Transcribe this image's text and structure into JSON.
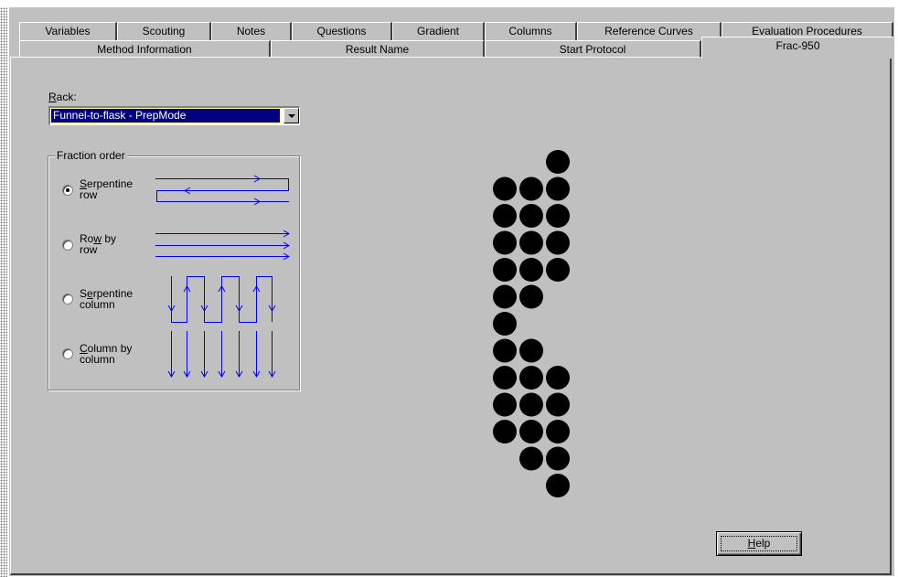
{
  "tabs_row1": [
    "Variables",
    "Scouting",
    "Notes",
    "Questions",
    "Gradient",
    "Columns",
    "Reference Curves",
    "Evaluation Procedures"
  ],
  "tabs_row2": [
    "Method Information",
    "Result Name",
    "Start Protocol",
    "Frac-950"
  ],
  "active_tab": "Frac-950",
  "rack": {
    "label_mnemonic": "R",
    "label_rest": "ack:",
    "selected_value": "Funnel-to-flask - PrepMode"
  },
  "fraction_order": {
    "title": "Fraction order",
    "options": [
      {
        "mnemonic": "S",
        "line1_rest": "erpentine",
        "line2": "row",
        "checked": true
      },
      {
        "line1_pre": "Ro",
        "mnemonic": "w",
        "line1_rest": " by",
        "line2": "row",
        "checked": false
      },
      {
        "line1_pre": "S",
        "mnemonic": "e",
        "line1_rest": "rpentine",
        "line2": "column",
        "checked": false
      },
      {
        "mnemonic": "C",
        "line1_rest": "olumn by",
        "line2": "column",
        "checked": false
      }
    ],
    "diagram_color": "#0000ff"
  },
  "rack_preview": {
    "columns": 3,
    "occupied": [
      [
        0,
        2
      ],
      [
        1,
        0
      ],
      [
        1,
        1
      ],
      [
        1,
        2
      ],
      [
        2,
        0
      ],
      [
        2,
        1
      ],
      [
        2,
        2
      ],
      [
        3,
        0
      ],
      [
        3,
        1
      ],
      [
        3,
        2
      ],
      [
        4,
        0
      ],
      [
        4,
        1
      ],
      [
        4,
        2
      ],
      [
        5,
        0
      ],
      [
        5,
        1
      ],
      [
        6,
        0
      ],
      [
        7,
        0
      ],
      [
        7,
        1
      ],
      [
        8,
        0
      ],
      [
        8,
        1
      ],
      [
        8,
        2
      ],
      [
        9,
        0
      ],
      [
        9,
        1
      ],
      [
        9,
        2
      ],
      [
        10,
        0
      ],
      [
        10,
        1
      ],
      [
        10,
        2
      ],
      [
        11,
        1
      ],
      [
        11,
        2
      ],
      [
        12,
        2
      ]
    ],
    "dot_color": "#000000"
  },
  "help_button": {
    "mnemonic": "H",
    "rest": "elp"
  }
}
